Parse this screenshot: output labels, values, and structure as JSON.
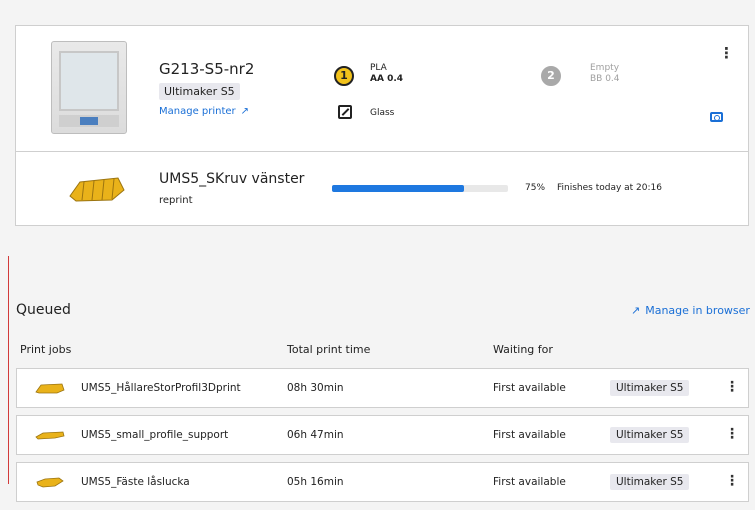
{
  "printer": {
    "name": "G213-S5-nr2",
    "type": "Ultimaker S5",
    "manage_label": "Manage printer",
    "core1": {
      "number": "1",
      "material": "PLA",
      "core": "AA 0.4"
    },
    "core2": {
      "number": "2",
      "material": "Empty",
      "core": "BB 0.4"
    },
    "buildplate": "Glass",
    "menu_icon": "more-vertical-icon",
    "camera_icon": "camera-icon"
  },
  "active_job": {
    "name": "UMS5_SKruv vänster",
    "subtitle": "reprint",
    "progress_percent": 75,
    "progress_label": "75%",
    "finish_label": "Finishes today at 20:16"
  },
  "queue": {
    "title": "Queued",
    "manage_browser_label": "Manage in browser",
    "columns": [
      "Print jobs",
      "Total print time",
      "Waiting for"
    ],
    "rows": [
      {
        "name": "UMS5_HållareStorProfil3Dprint",
        "time": "08h 30min",
        "waiting": "First available",
        "printer_type": "Ultimaker S5"
      },
      {
        "name": "UMS5_small_profile_support",
        "time": "06h 47min",
        "waiting": "First available",
        "printer_type": "Ultimaker S5"
      },
      {
        "name": "UMS5_Fäste låslucka",
        "time": "05h 16min",
        "waiting": "First available",
        "printer_type": "Ultimaker S5"
      }
    ]
  },
  "colors": {
    "accent": "#1a6fd6",
    "progress": "#1e78e0",
    "core1": "#f2c21b",
    "core2": "#a9a9a9"
  }
}
